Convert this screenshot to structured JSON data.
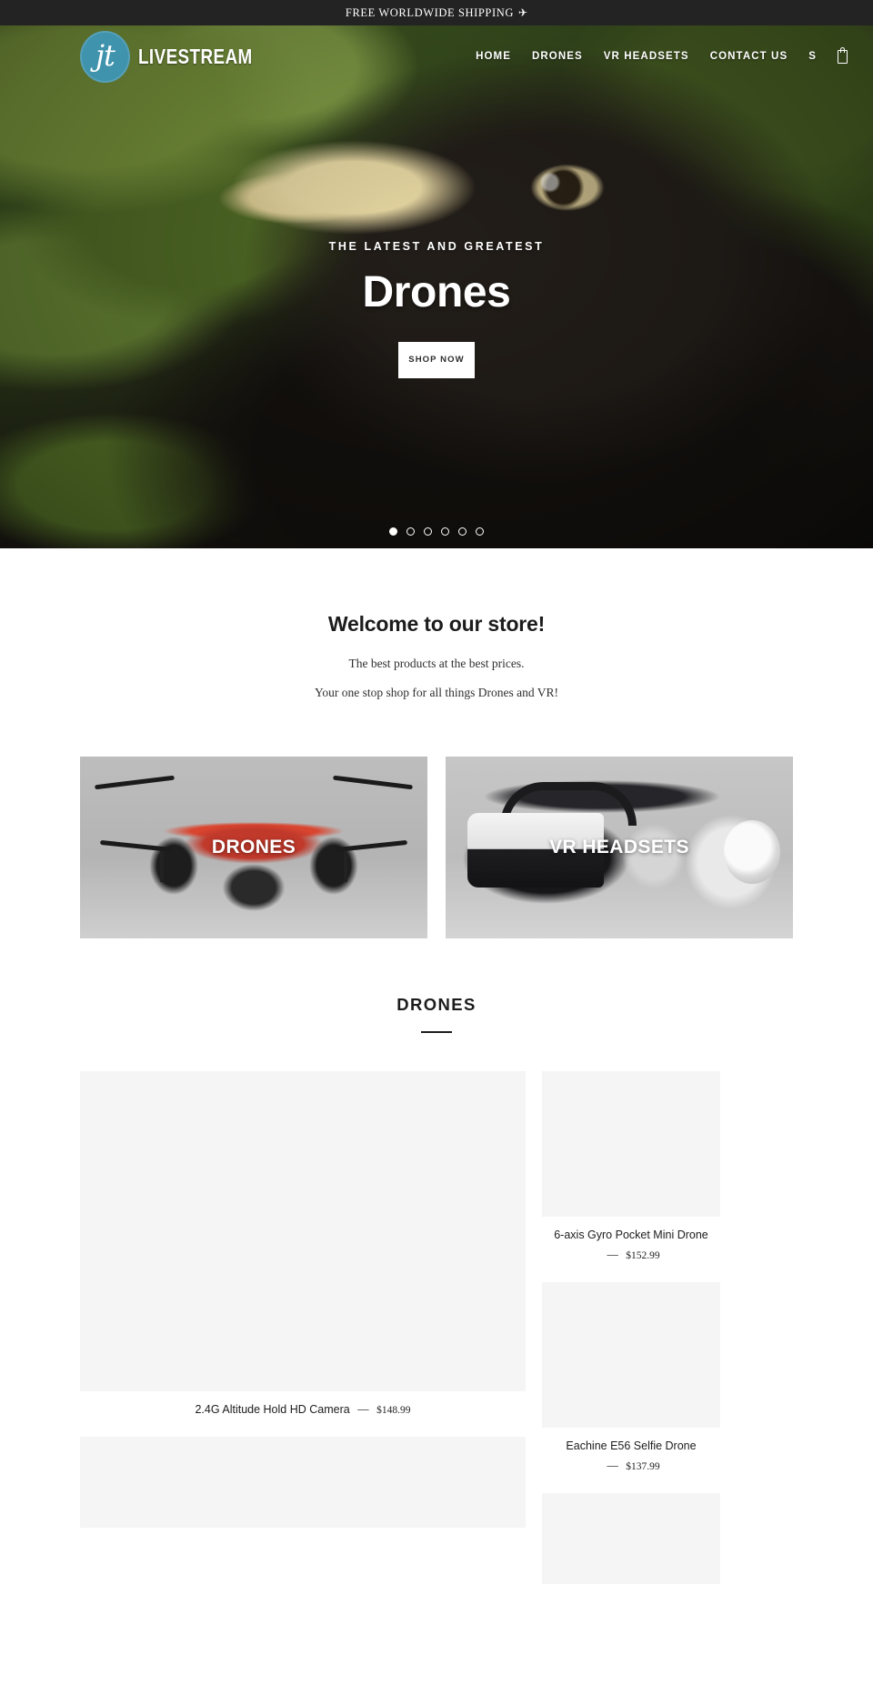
{
  "announcement": {
    "text": "FREE WORLDWIDE SHIPPING",
    "icon": "airplane-icon"
  },
  "header": {
    "logo": {
      "monogram": "jt",
      "wordmark": "LIVESTREAM",
      "badge_color": "#3f93ad"
    },
    "nav": [
      {
        "label": "HOME"
      },
      {
        "label": "DRONES"
      },
      {
        "label": "VR HEADSETS"
      },
      {
        "label": "CONTACT US"
      }
    ],
    "search_label": "S",
    "cart_icon": "cart-icon"
  },
  "hero": {
    "eyebrow": "THE LATEST AND GREATEST",
    "title": "Drones",
    "button_label": "SHOP NOW",
    "button_sub": "",
    "slides_total": 6,
    "active_slide": 1
  },
  "welcome": {
    "heading": "Welcome to our store!",
    "line1": "The best products at the best prices.",
    "line2": "Your one stop shop for all things Drones and VR!"
  },
  "collections": [
    {
      "label": "DRONES",
      "image": "drone-photo"
    },
    {
      "label": "VR HEADSETS",
      "image": "vr-headset-photo"
    }
  ],
  "drones_section": {
    "heading": "DRONES"
  },
  "products": {
    "left": [
      {
        "title": "2.4G Altitude Hold HD Camera",
        "price": "$148.99",
        "layout": "inline",
        "image_size": "tall"
      }
    ],
    "right": [
      {
        "title": "6-axis Gyro Pocket Mini Drone",
        "price": "$152.99",
        "layout": "stack",
        "image_size": "small"
      },
      {
        "title": "Eachine E56 Selfie Drone",
        "price": "$137.99",
        "layout": "stack",
        "image_size": "small",
        "sold_out": true
      }
    ],
    "bottom_left": [
      {
        "title": "",
        "price": "",
        "image_size": "mini"
      }
    ],
    "bottom_right": [
      {
        "title": "",
        "price": "",
        "image_size": "mini"
      }
    ],
    "price_separator": "—"
  },
  "colors": {
    "announcement_bg": "#232323",
    "accent": "#3f93ad",
    "placeholder": "#f5f5f5"
  }
}
